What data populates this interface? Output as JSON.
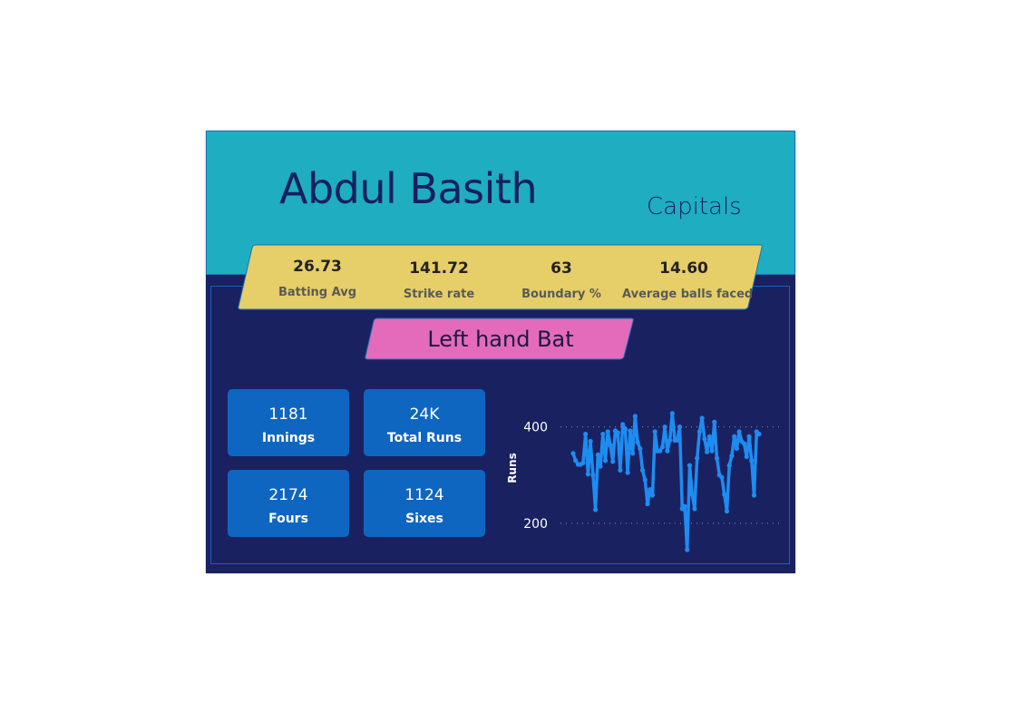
{
  "player": {
    "name": "Abdul Basith",
    "team": "Capitals"
  },
  "stats": [
    {
      "value": "26.73",
      "label": "Batting Avg"
    },
    {
      "value": "141.72",
      "label": "Strike rate"
    },
    {
      "value": "63",
      "label": "Boundary %"
    },
    {
      "value": "14.60",
      "label": "Average balls faced"
    }
  ],
  "batting_hand": "Left hand Bat",
  "kpis": {
    "innings": {
      "value": "1181",
      "label": "Innings"
    },
    "total_runs": {
      "value": "24K",
      "label": "Total Runs"
    },
    "fours": {
      "value": "2174",
      "label": "Fours"
    },
    "sixes": {
      "value": "1124",
      "label": "Sixes"
    }
  },
  "colors": {
    "header_bg": "#1fadc2",
    "body_bg": "#1a2160",
    "stats_band": "#e6ce68",
    "hand_badge": "#e46bbb",
    "kpi_card": "#0f66c0",
    "line": "#1e8cf0"
  },
  "chart_data": {
    "type": "line",
    "title": "",
    "xlabel": "",
    "ylabel": "Runs",
    "yticks": [
      200,
      400
    ],
    "ylim": [
      130,
      450
    ],
    "grid": "dotted-horizontal",
    "series": [
      {
        "values": [
          345,
          330,
          322,
          322,
          325,
          385,
          302,
          370,
          300,
          228,
          342,
          318,
          385,
          330,
          390,
          362,
          328,
          392,
          388,
          310,
          405,
          395,
          305,
          392,
          345,
          422,
          368,
          355,
          310,
          290,
          240,
          270,
          258,
          390,
          350,
          350,
          358,
          400,
          350,
          372,
          428,
          372,
          372,
          400,
          230,
          235,
          145,
          320,
          260,
          230,
          335,
          390,
          418,
          375,
          348,
          380,
          350,
          410,
          335,
          300,
          295,
          260,
          225,
          320,
          340,
          380,
          355,
          390,
          370,
          365,
          338,
          380,
          330,
          258,
          390,
          385
        ]
      }
    ]
  }
}
